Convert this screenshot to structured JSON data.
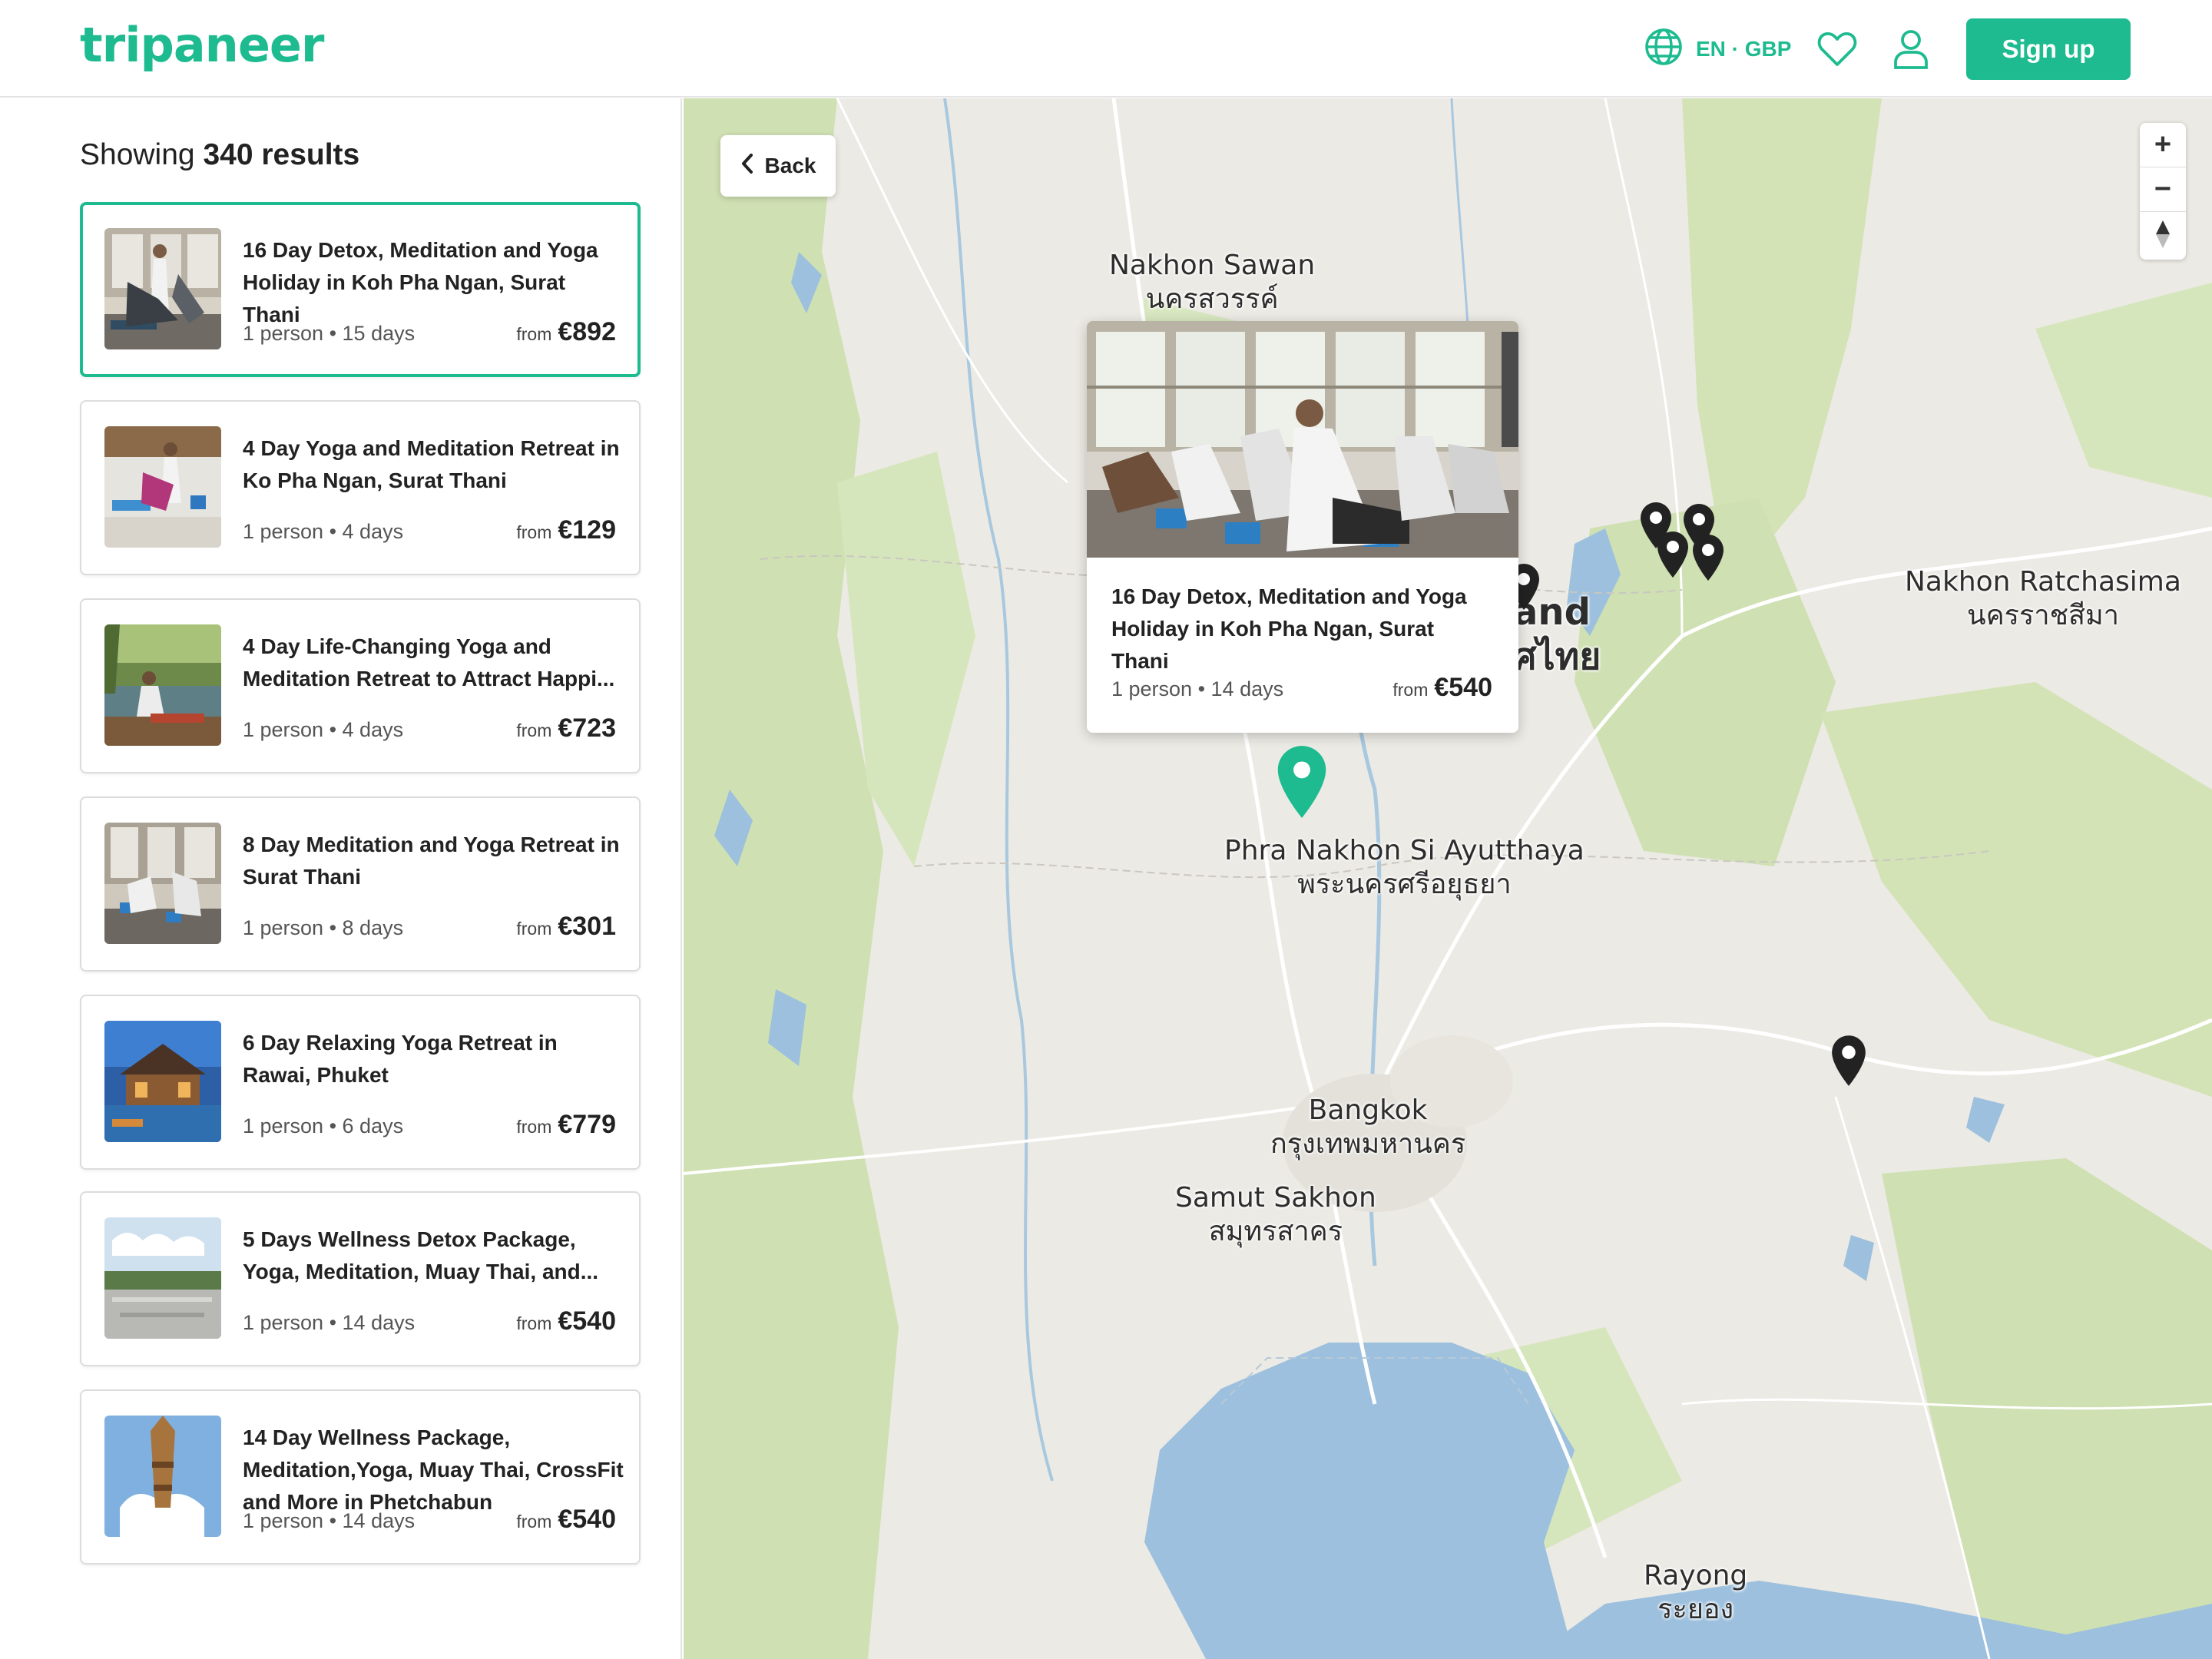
{
  "header": {
    "logo": "tripaneer",
    "language": "EN · GBP",
    "signup_label": "Sign up",
    "icons": [
      "globe-icon",
      "heart-icon",
      "user-icon"
    ]
  },
  "results": {
    "prefix": "Showing ",
    "count": "340 results",
    "cards": [
      {
        "title": "16 Day Detox, Meditation and Yoga Holiday in Koh Pha Ngan, Surat Thani",
        "meta": "1 person • 15 days",
        "from": "from",
        "price": "€892",
        "selected": true
      },
      {
        "title": "4 Day Yoga and Meditation Retreat in Ko Pha Ngan, Surat Thani",
        "meta": "1 person • 4 days",
        "from": "from",
        "price": "€129"
      },
      {
        "title": "4 Day Life-Changing Yoga and Meditation Retreat to Attract Happi...",
        "meta": "1 person • 4 days",
        "from": "from",
        "price": "€723"
      },
      {
        "title": "8 Day Meditation and Yoga Retreat in Surat Thani",
        "meta": "1 person • 8 days",
        "from": "from",
        "price": "€301"
      },
      {
        "title": "6 Day Relaxing Yoga Retreat in Rawai, Phuket",
        "meta": "1 person • 6 days",
        "from": "from",
        "price": "€779"
      },
      {
        "title": "5 Days Wellness Detox Package, Yoga, Meditation, Muay Thai, and...",
        "meta": "1 person • 14 days",
        "from": "from",
        "price": "€540"
      },
      {
        "title": "14 Day Wellness Package, Meditation,Yoga, Muay Thai, CrossFit and More in Phetchabun",
        "meta": "1 person • 14 days",
        "from": "from",
        "price": "€540"
      }
    ]
  },
  "map": {
    "back_label": "Back",
    "zoom_in": "+",
    "zoom_out": "−",
    "compass": "▲",
    "labels": {
      "nakhon_sawan": "Nakhon Sawan",
      "nakhon_sawan_th": "นครสวรรค์",
      "nakhon_ratchasima": "Nakhon Ratchasima",
      "nakhon_ratchasima_th": "นครราชสีมา",
      "thailand_fragment": "and",
      "thailand_fragment_th": "ศไทย",
      "ayutthaya": "Phra Nakhon Si Ayutthaya",
      "ayutthaya_th": "พระนครศรีอยุธยา",
      "bangkok": "Bangkok",
      "bangkok_th": "กรุงเทพมหานคร",
      "samut_sakhon": "Samut Sakhon",
      "samut_sakhon_th": "สมุทรสาคร",
      "rayong": "Rayong",
      "rayong_th": "ระยอง"
    },
    "popup": {
      "title": "16 Day Detox, Meditation and Yoga Holiday in Koh Pha Ngan, Surat Thani",
      "meta": "1 person • 14 days",
      "from": "from",
      "price": "€540"
    },
    "colors": {
      "land": "#eceae4",
      "forest": "#cfe0b2",
      "water": "#9cc0de",
      "accent": "#1dbb8f",
      "pin": "#222222"
    }
  }
}
